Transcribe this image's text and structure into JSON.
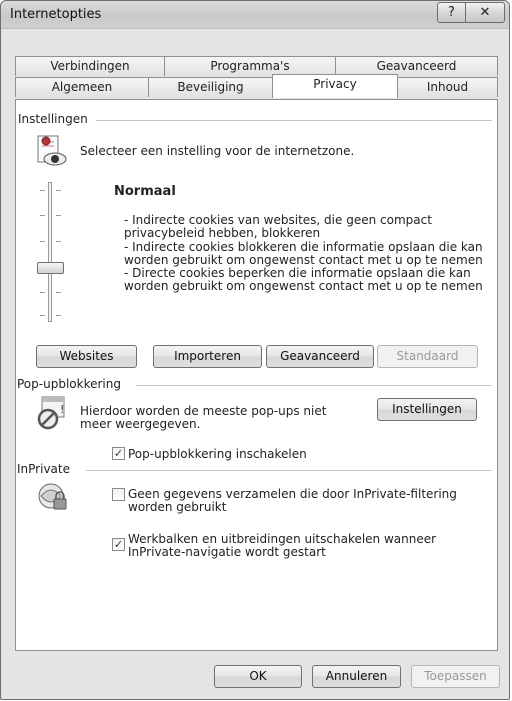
{
  "window": {
    "title": "Internetopties",
    "help_label": "?",
    "close_label": "✕"
  },
  "tabs": {
    "row1": [
      "Verbindingen",
      "Programma's",
      "Geavanceerd"
    ],
    "row2": [
      "Algemeen",
      "Beveiliging",
      "Privacy",
      "Inhoud"
    ],
    "active": "Privacy"
  },
  "settings": {
    "group_label": "Instellingen",
    "instruction": "Selecteer een instelling voor de internetzone.",
    "level_title": "Normaal",
    "bullets": [
      "- Indirecte cookies van websites, die geen compact",
      "privacybeleid hebben, blokkeren",
      "- Indirecte cookies blokkeren die informatie opslaan die kan",
      "worden gebruikt om ongewenst contact met u op te nemen",
      "- Directe cookies beperken die informatie opslaan die kan",
      "worden gebruikt om ongewenst contact met u op te nemen"
    ],
    "buttons": {
      "websites": "Websites",
      "import": "Importeren",
      "advanced": "Geavanceerd",
      "default": "Standaard"
    }
  },
  "popup": {
    "group_label": "Pop-upblokkering",
    "description": [
      "Hierdoor worden de meeste pop-ups niet",
      "meer weergegeven."
    ],
    "settings_button": "Instellingen",
    "enable_label": "Pop-upblokkering inschakelen",
    "enable_checked": true
  },
  "inprivate": {
    "group_label": "InPrivate",
    "option1": [
      "Geen gegevens verzamelen die door InPrivate-filtering",
      "worden gebruikt"
    ],
    "option1_checked": false,
    "option2": [
      "Werkbalken en uitbreidingen uitschakelen wanneer",
      "InPrivate-navigatie wordt gestart"
    ],
    "option2_checked": true
  },
  "footer": {
    "ok": "OK",
    "cancel": "Annuleren",
    "apply": "Toepassen"
  }
}
